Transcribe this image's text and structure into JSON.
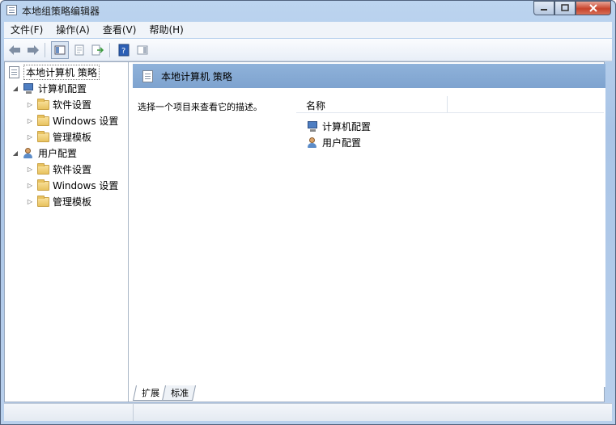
{
  "window": {
    "title": "本地组策略编辑器"
  },
  "menu": [
    "文件(F)",
    "操作(A)",
    "查看(V)",
    "帮助(H)"
  ],
  "toolbar": [
    "back-arrow-icon",
    "forward-arrow-icon",
    "show-hide-tree-icon",
    "properties-icon",
    "export-list-icon",
    "help-icon",
    "show-action-pane-icon"
  ],
  "tree": {
    "root": "本地计算机 策略",
    "computer": {
      "label": "计算机配置",
      "children": [
        "软件设置",
        "Windows 设置",
        "管理模板"
      ]
    },
    "user": {
      "label": "用户配置",
      "children": [
        "软件设置",
        "Windows 设置",
        "管理模板"
      ]
    }
  },
  "panel": {
    "header": "本地计算机 策略",
    "description": "选择一个项目来查看它的描述。",
    "column_name": "名称",
    "items": [
      "计算机配置",
      "用户配置"
    ]
  },
  "tabs": [
    "扩展",
    "标准"
  ]
}
